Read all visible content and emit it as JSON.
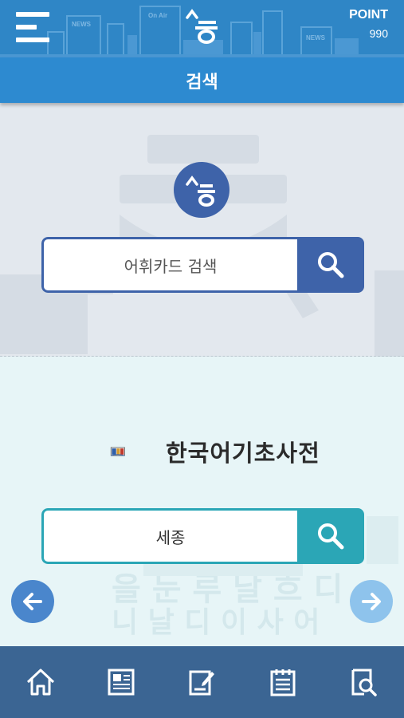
{
  "header": {
    "point_label": "POINT",
    "point_value": "990",
    "city_sign_1": "NEWS",
    "city_sign_2": "On Air",
    "city_sign_3": "NEWS"
  },
  "titlebar": {
    "title": "검색"
  },
  "vocab_search": {
    "placeholder": "어휘카드 검색"
  },
  "dictionary": {
    "title": "한국어기초사전",
    "search_value": "세종"
  },
  "bg_text": {
    "line1": "을 눈 루 날 흐 디",
    "line2": "니 날 디 이 사 어"
  },
  "bottom_tabs": [
    {
      "icon": "home-icon"
    },
    {
      "icon": "news-icon"
    },
    {
      "icon": "edit-note-icon"
    },
    {
      "icon": "notepad-icon"
    },
    {
      "icon": "book-search-icon"
    }
  ],
  "colors": {
    "header": "#2f86c6",
    "search_primary": "#3e63a9",
    "search_teal": "#2ba6b6",
    "bottom_bar": "#3b6593"
  }
}
